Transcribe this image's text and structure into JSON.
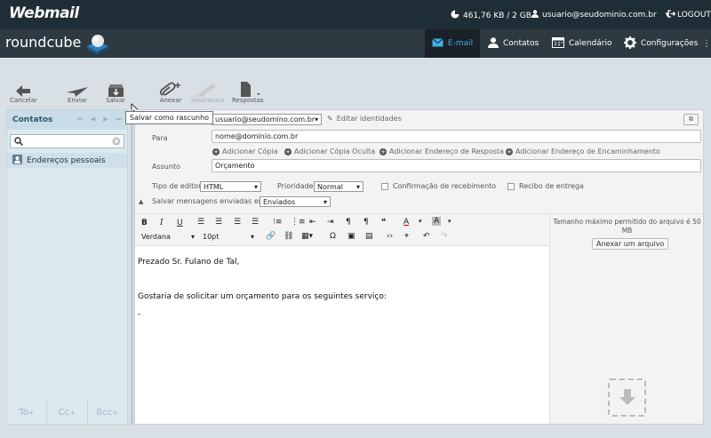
{
  "topbar": {
    "logo": "Webmail",
    "quota": "461,76 KB / 2 GB",
    "user": "usuario@seudominio.com.br",
    "logout": "LOGOUT"
  },
  "nav": {
    "brand": "roundcube",
    "items": [
      {
        "label": "E-mail",
        "icon": "envelope-icon",
        "active": true
      },
      {
        "label": "Contatos",
        "icon": "person-icon"
      },
      {
        "label": "Calendário",
        "icon": "calendar-icon"
      },
      {
        "label": "Configurações",
        "icon": "gear-icon"
      }
    ]
  },
  "toolbar": {
    "cancel": "Cancelar",
    "send": "Enviar",
    "save": "Salvar",
    "attach": "Anexar",
    "signature": "Assinatura",
    "responses": "Respostas",
    "tooltip": "Salvar como rascunho"
  },
  "contacts": {
    "title": "Contatos",
    "search_placeholder": "",
    "items": [
      "Endereços pessoais"
    ],
    "footer": [
      "To",
      "Cc",
      "Bcc"
    ]
  },
  "compose": {
    "from": "usuario@seudomino.com.br",
    "edit_identities": "Editar identidades",
    "to_label": "Para",
    "to_value": "nome@dominio.com.br",
    "add_links": [
      "Adicionar Cópia",
      "Adicionar Cópia Oculta",
      "Adicionar Endereço de Resposta",
      "Adicionar Endereço de Encaminhamento"
    ],
    "subject_label": "Assunto",
    "subject_value": "Orçamento",
    "editor_type_label": "Tipo de editor",
    "editor_type_value": "HTML",
    "priority_label": "Prioridade",
    "priority_value": "Normal",
    "receipt_label": "Confirmação de recebimento",
    "delivery_label": "Recibo de entrega",
    "save_sent_label": "Salvar mensagens enviadas em",
    "save_sent_value": "Enviados",
    "font_family": "Verdana",
    "font_size": "10pt",
    "body_lines": [
      "Prezado Sr. Fulano de Tal,",
      "",
      "Gostaria de solicitar um orçamento para os seguintes serviço:",
      "-"
    ],
    "max_size": "Tamanho máximo permitido do arquivo é 50 MB",
    "attach_button": "Anexar um arquivo"
  },
  "colors": {
    "topbar": "#1f2d36",
    "navbar": "#2e3a42",
    "accent": "#3fb0e9",
    "panel": "#dce9ef"
  }
}
